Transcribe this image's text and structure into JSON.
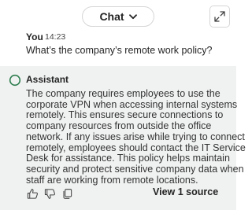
{
  "header": {
    "mode_label": "Chat",
    "icons": {
      "mode_dropdown": "chevron-down-icon",
      "expand": "expand-icon"
    }
  },
  "user_message": {
    "author": "You",
    "time": "14:23",
    "text": "What’s the company’s remote work policy?"
  },
  "assistant_message": {
    "author": "Assistant",
    "icon": "assistant-ring-icon",
    "lines": [
      "The company requires employees to use the",
      "corporate VPN when accessing internal systems",
      "remotely. This ensures secure connections to",
      "company resources from outside the office",
      "network. If any issues arise while trying to connect",
      "remotely, employees should contact the IT Service",
      "Desk for assistance. This policy helps maintain",
      "security and protect sensitive company data when",
      "staff are working from remote locations."
    ]
  },
  "footer": {
    "icons": [
      "thumbs-up-icon",
      "thumbs-down-icon",
      "copy-icon"
    ],
    "sources_label": "View 1 source"
  },
  "colors": {
    "assistant_panel_bg": "#f0f2f1",
    "assistant_ring": "#2e7d4f",
    "text": "#242424",
    "border": "#d6d6d6"
  }
}
